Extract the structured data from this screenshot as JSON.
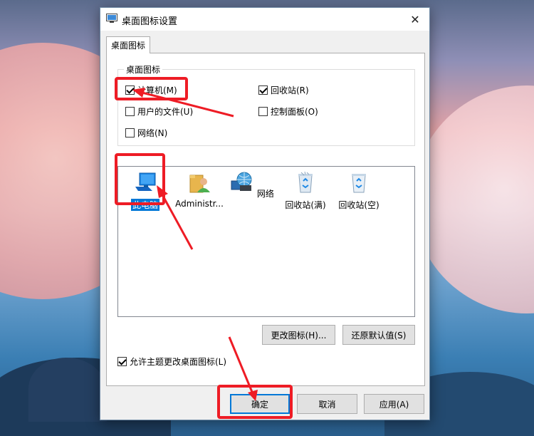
{
  "window": {
    "title": "桌面图标设置",
    "close": "✕"
  },
  "tab": {
    "label": "桌面图标"
  },
  "group": {
    "title": "桌面图标",
    "items": [
      {
        "label": "计算机(M)",
        "checked": true
      },
      {
        "label": "回收站(R)",
        "checked": true
      },
      {
        "label": "用户的文件(U)",
        "checked": false
      },
      {
        "label": "控制面板(O)",
        "checked": false
      },
      {
        "label": "网络(N)",
        "checked": false
      }
    ]
  },
  "icons": [
    {
      "name": "此电脑",
      "icon": "computer-icon",
      "selected": true
    },
    {
      "name": "Administr...",
      "icon": "user-folder-icon",
      "selected": false
    },
    {
      "name": "网络",
      "icon": "network-icon",
      "selected": false
    },
    {
      "name": "回收站(满)",
      "icon": "recycle-bin-full-icon",
      "selected": false
    },
    {
      "name": "回收站(空)",
      "icon": "recycle-bin-empty-icon",
      "selected": false
    }
  ],
  "buttons": {
    "change_icon": "更改图标(H)...",
    "restore_default": "还原默认值(S)",
    "ok": "确定",
    "cancel": "取消",
    "apply": "应用(A)"
  },
  "allow_themes": {
    "label": "允许主题更改桌面图标(L)",
    "checked": true
  },
  "colors": {
    "accent": "#0078d7",
    "annotation": "#ee1c25"
  }
}
